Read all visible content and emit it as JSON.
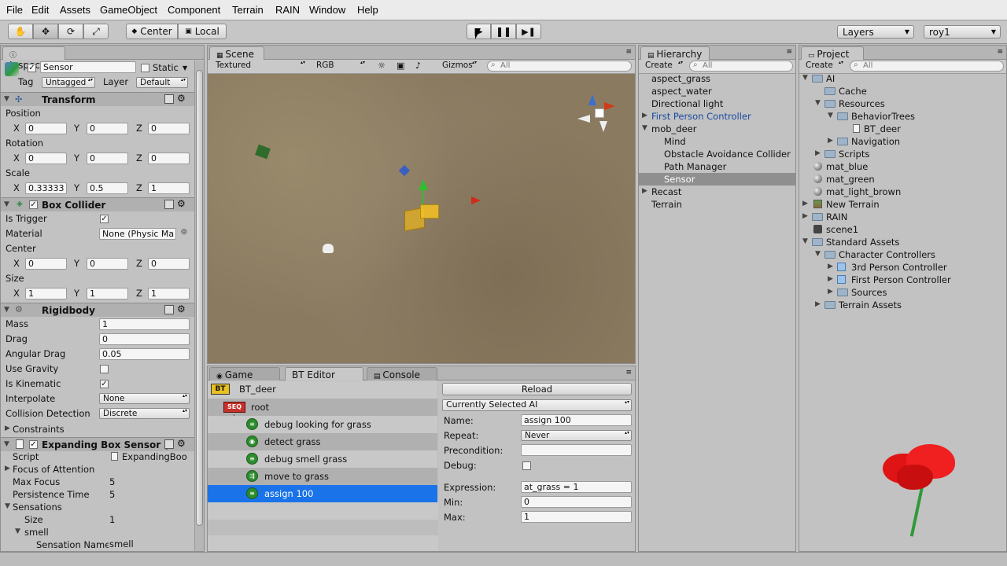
{
  "menu": [
    "File",
    "Edit",
    "Assets",
    "GameObject",
    "Component",
    "Terrain",
    "RAIN",
    "Window",
    "Help"
  ],
  "toolbar": {
    "pivot_label": "Center",
    "space_label": "Local",
    "layers_label": "Layers",
    "layout_label": "roy1"
  },
  "inspector": {
    "tab": "Inspector",
    "object_name": "Sensor",
    "static_label": "Static",
    "tag_label": "Tag",
    "tag_value": "Untagged",
    "layer_label": "Layer",
    "layer_value": "Default",
    "transform": {
      "title": "Transform",
      "position_label": "Position",
      "position": {
        "x": "0",
        "y": "0",
        "z": "0"
      },
      "rotation_label": "Rotation",
      "rotation": {
        "x": "0",
        "y": "0",
        "z": "0"
      },
      "scale_label": "Scale",
      "scale": {
        "x": "0.33333",
        "y": "0.5",
        "z": "1"
      }
    },
    "box_collider": {
      "title": "Box Collider",
      "is_trigger_label": "Is Trigger",
      "material_label": "Material",
      "material_value": "None (Physic Ma",
      "center_label": "Center",
      "center": {
        "x": "0",
        "y": "0",
        "z": "0"
      },
      "size_label": "Size",
      "size": {
        "x": "1",
        "y": "1",
        "z": "1"
      }
    },
    "rigidbody": {
      "title": "Rigidbody",
      "mass_label": "Mass",
      "mass": "1",
      "drag_label": "Drag",
      "drag": "0",
      "angular_drag_label": "Angular Drag",
      "angular_drag": "0.05",
      "use_gravity_label": "Use Gravity",
      "is_kinematic_label": "Is Kinematic",
      "interpolate_label": "Interpolate",
      "interpolate": "None",
      "collision_label": "Collision Detection",
      "collision": "Discrete",
      "constraints_label": "Constraints"
    },
    "sensor": {
      "title": "Expanding Box Sensor (",
      "script_label": "Script",
      "script_value": "ExpandingBoo",
      "focus_label": "Focus of Attention",
      "max_focus_label": "Max Focus",
      "max_focus": "5",
      "persistence_label": "Persistence Time",
      "persistence": "5",
      "sensations_label": "Sensations",
      "size_label": "Size",
      "size": "1",
      "smell_label": "smell",
      "sensation_name_label": "Sensation Name",
      "sensation_name": "smell"
    },
    "axis": {
      "x": "X",
      "y": "Y",
      "z": "Z"
    }
  },
  "scene": {
    "tab": "Scene",
    "render_mode": "Textured",
    "color_mode": "RGB",
    "gizmos_label": "Gizmos",
    "search_placeholder": "All"
  },
  "bottom_tabs": {
    "game": "Game",
    "bt_editor": "BT Editor",
    "console": "Console"
  },
  "bt_editor": {
    "badge": "BT",
    "tree_name": "BT_deer",
    "root_badge": "SEQ",
    "root_label": "root",
    "nodes": [
      "debug looking for grass",
      "detect grass",
      "debug smell grass",
      "move to grass",
      "assign 100"
    ],
    "reload_label": "Reload",
    "ai_select": "Currently Selected AI",
    "name_label": "Name:",
    "name_value": "assign 100",
    "repeat_label": "Repeat:",
    "repeat_value": "Never",
    "precondition_label": "Precondition:",
    "debug_label": "Debug:",
    "expression_label": "Expression:",
    "expression_value": "at_grass = 1",
    "min_label": "Min:",
    "min_value": "0",
    "max_label": "Max:",
    "max_value": "1"
  },
  "hierarchy": {
    "tab": "Hierarchy",
    "create_label": "Create",
    "search_placeholder": "All",
    "items": [
      "aspect_grass",
      "aspect_water",
      "Directional light",
      "First Person Controller",
      "mob_deer",
      "Mind",
      "Obstacle Avoidance Collider",
      "Path Manager",
      "Sensor",
      "Recast",
      "Terrain"
    ]
  },
  "project": {
    "tab": "Project",
    "create_label": "Create",
    "search_placeholder": "All",
    "items": [
      "AI",
      "Cache",
      "Resources",
      "BehaviorTrees",
      "BT_deer",
      "Navigation",
      "Scripts",
      "mat_blue",
      "mat_green",
      "mat_light_brown",
      "New Terrain",
      "RAIN",
      "scene1",
      "Standard Assets",
      "Character Controllers",
      "3rd Person Controller",
      "First Person Controller",
      "Sources",
      "Terrain Assets"
    ]
  }
}
